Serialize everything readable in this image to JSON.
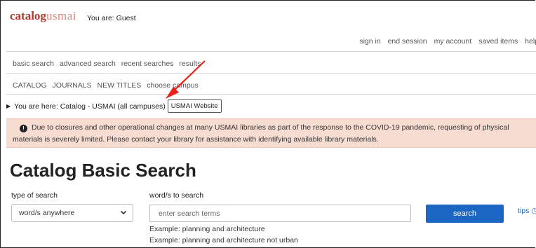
{
  "header": {
    "logo_part1": "catalog",
    "logo_part2": "usmai",
    "you_are": "You are: Guest"
  },
  "top_nav": [
    "sign in",
    "end session",
    "my account",
    "saved items",
    "help"
  ],
  "search_nav": [
    "basic search",
    "advanced search",
    "recent searches",
    "results"
  ],
  "catalog_nav": [
    "CATALOG",
    "JOURNALS",
    "NEW TITLES",
    "choose campus"
  ],
  "breadcrumb": {
    "text": "You are here: Catalog - USMAI (all campuses)",
    "website_button": "USMAI Website"
  },
  "alert": {
    "line1": "Due to closures and other operational changes at many USMAI libraries as part of the response to the COVID-19 pandemic, requesting of physical",
    "line2": "materials is severely limited. Please contact your library for assistance with identifying available library materials."
  },
  "page_title": "Catalog Basic Search",
  "form": {
    "type_label": "type of search",
    "type_value": "word/s anywhere",
    "words_label": "word/s to search",
    "words_placeholder": "enter search terms",
    "search_button": "search",
    "tips": "tips",
    "examples": [
      "Example: planning and architecture",
      "Example: planning and architecture not urban"
    ]
  },
  "annotation_color": "#e8231a"
}
